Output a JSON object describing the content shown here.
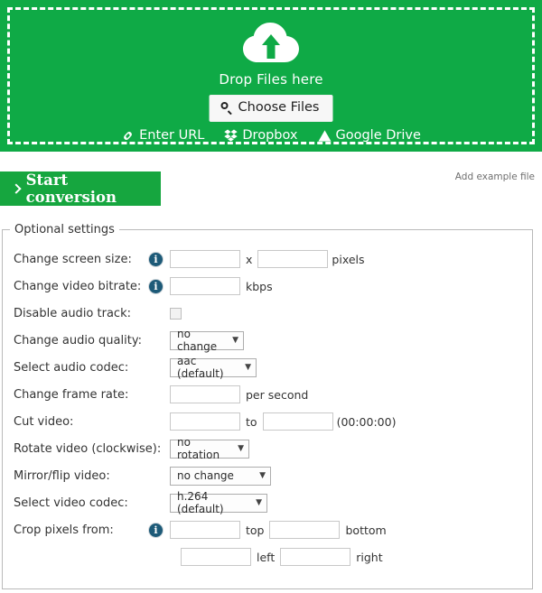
{
  "colors": {
    "brand_green": "#0faa46",
    "button_green": "#16a63f",
    "info_icon": "#1d5a78"
  },
  "dropzone": {
    "icon": "cloud-upload-icon",
    "drop_text": "Drop Files here",
    "choose_files_label": "Choose Files",
    "choose_files_icon": "search-icon",
    "services": [
      {
        "label": "Enter URL",
        "icon": "link-icon"
      },
      {
        "label": "Dropbox",
        "icon": "dropbox-icon"
      },
      {
        "label": "Google Drive",
        "icon": "google-drive-icon"
      }
    ]
  },
  "actions": {
    "start_conversion_label": "Start conversion",
    "start_conversion_icon": "chevron-right-icon",
    "add_example_file_label": "Add example file"
  },
  "settings": {
    "legend": "Optional settings",
    "rows": [
      {
        "label": "Change screen size:",
        "info": true,
        "type": "two-inputs",
        "value1": "",
        "value2": "",
        "separator": "x",
        "unit": "pixels"
      },
      {
        "label": "Change video bitrate:",
        "info": true,
        "type": "one-input",
        "value1": "",
        "unit": "kbps"
      },
      {
        "label": "Disable audio track:",
        "info": false,
        "type": "checkbox",
        "checked": false
      },
      {
        "label": "Change audio quality:",
        "info": false,
        "type": "select",
        "selected": "no change"
      },
      {
        "label": "Select audio codec:",
        "info": false,
        "type": "select",
        "selected": "aac (default)"
      },
      {
        "label": "Change frame rate:",
        "info": false,
        "type": "one-input",
        "value1": "",
        "unit": "per second"
      },
      {
        "label": "Cut video:",
        "info": false,
        "type": "two-inputs",
        "value1": "",
        "value2": "",
        "separator": "to",
        "unit": "(00:00:00)"
      },
      {
        "label": "Rotate video (clockwise):",
        "info": false,
        "type": "select",
        "selected": "no rotation"
      },
      {
        "label": "Mirror/flip video:",
        "info": false,
        "type": "select",
        "selected": "no change"
      },
      {
        "label": "Select video codec:",
        "info": false,
        "type": "select",
        "selected": "h.264 (default)"
      },
      {
        "label": "Crop pixels from:",
        "info": true,
        "type": "crop",
        "top_value": "",
        "top_unit": "top",
        "bottom_value": "",
        "bottom_unit": "bottom",
        "left_value": "",
        "left_unit": "left",
        "right_value": "",
        "right_unit": "right"
      }
    ],
    "info_glyph": "i"
  }
}
